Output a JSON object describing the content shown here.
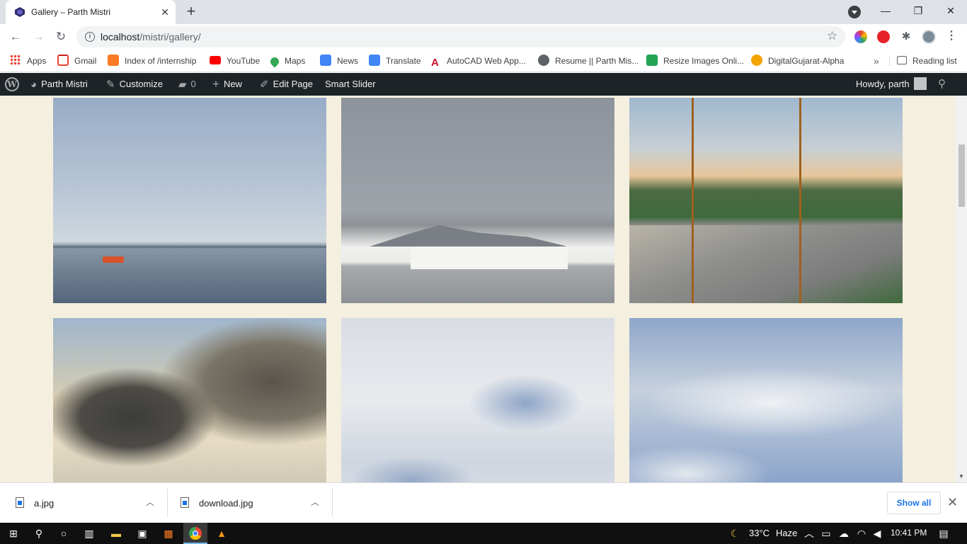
{
  "browser": {
    "tab_title": "Gallery – Parth Mistri",
    "url": "localhost/mistri/gallery/",
    "url_host": "localhost",
    "url_path": "/mistri/gallery/"
  },
  "bookmarks": [
    {
      "label": "Apps",
      "icon": "apps-grid-icon",
      "color": "#1a73e8"
    },
    {
      "label": "Gmail",
      "icon": "gmail-icon",
      "color": "#ea4335"
    },
    {
      "label": "Index of /internship",
      "icon": "xampp-icon",
      "color": "#fb7a24"
    },
    {
      "label": "YouTube",
      "icon": "youtube-icon",
      "color": "#ff0000"
    },
    {
      "label": "Maps",
      "icon": "maps-pin-icon",
      "color": "#34a853"
    },
    {
      "label": "News",
      "icon": "news-icon",
      "color": "#4285f4"
    },
    {
      "label": "Translate",
      "icon": "translate-icon",
      "color": "#4285f4"
    },
    {
      "label": "AutoCAD Web App...",
      "icon": "autocad-icon",
      "color": "#c8102e"
    },
    {
      "label": "Resume || Parth Mis...",
      "icon": "globe-icon",
      "color": "#5f6368"
    },
    {
      "label": "Resize Images Onli...",
      "icon": "resize-icon",
      "color": "#23a455"
    },
    {
      "label": "DigitalGujarat-Alpha",
      "icon": "digitalgujarat-icon",
      "color": "#f4a300"
    }
  ],
  "reading_list": "Reading list",
  "adminbar": {
    "site_name": "Parth Mistri",
    "customize": "Customize",
    "comments_count": "0",
    "new": "New",
    "edit_page": "Edit Page",
    "smart_slider": "Smart Slider",
    "howdy": "Howdy, parth"
  },
  "gallery": [
    {
      "name": "lake-boat-photo",
      "alt": "Lake with boat"
    },
    {
      "name": "lake-palace-photo",
      "alt": "Lake palace"
    },
    {
      "name": "road-sunset-photo",
      "alt": "Road at sunset"
    },
    {
      "name": "dark-clouds-photo",
      "alt": "Dark clouds"
    },
    {
      "name": "white-clouds-photo",
      "alt": "White clouds"
    },
    {
      "name": "blue-sky-clouds-photo",
      "alt": "Blue sky clouds"
    }
  ],
  "downloads": [
    {
      "name": "a.jpg"
    },
    {
      "name": "download.jpg"
    }
  ],
  "show_all": "Show all",
  "taskbar": {
    "temperature": "33°C",
    "weather": "Haze",
    "time": "10:41 PM"
  },
  "colors": {
    "page_bg": "#f5efe0",
    "adminbar_bg": "#1d2327",
    "accent": "#1a73e8"
  }
}
